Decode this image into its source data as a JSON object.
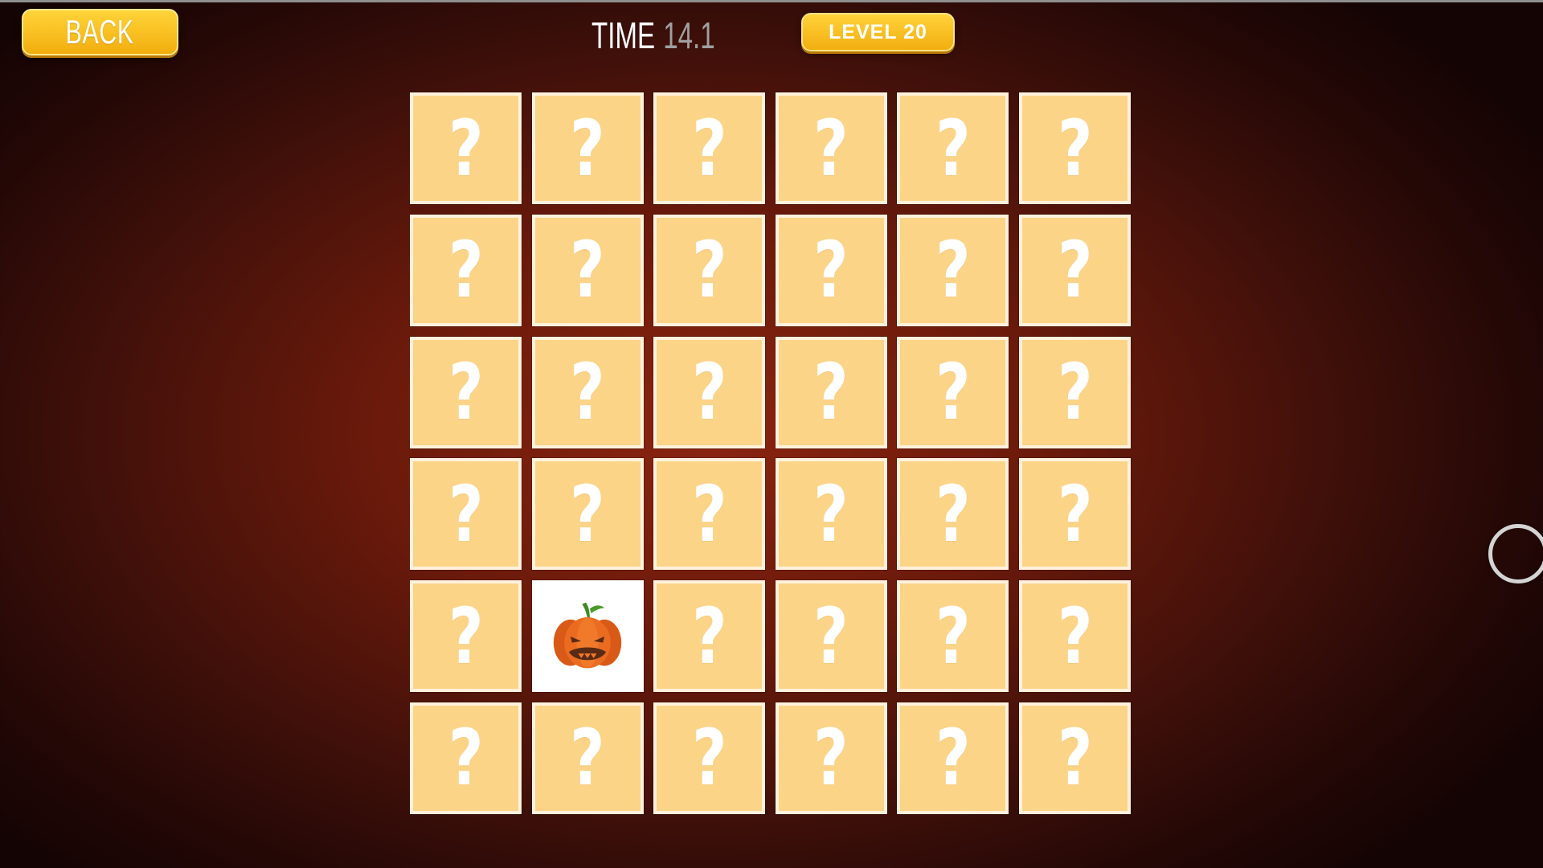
{
  "header": {
    "back_label": "BACK",
    "timer_label": "TIME",
    "timer_value": "14.1",
    "level_label": "LEVEL 20"
  },
  "board": {
    "rows": 6,
    "columns": 6,
    "hidden_symbol": "?",
    "cards": [
      {
        "face": "?"
      },
      {
        "face": "?"
      },
      {
        "face": "?"
      },
      {
        "face": "?"
      },
      {
        "face": "?"
      },
      {
        "face": "?"
      },
      {
        "face": "?"
      },
      {
        "face": "?"
      },
      {
        "face": "?"
      },
      {
        "face": "?"
      },
      {
        "face": "?"
      },
      {
        "face": "?"
      },
      {
        "face": "?"
      },
      {
        "face": "?"
      },
      {
        "face": "?"
      },
      {
        "face": "?"
      },
      {
        "face": "?"
      },
      {
        "face": "?"
      },
      {
        "face": "?"
      },
      {
        "face": "?"
      },
      {
        "face": "?"
      },
      {
        "face": "?"
      },
      {
        "face": "?"
      },
      {
        "face": "?"
      },
      {
        "face": "?"
      },
      {
        "face": "pumpkin-icon",
        "revealed": true
      },
      {
        "face": "?"
      },
      {
        "face": "?"
      },
      {
        "face": "?"
      },
      {
        "face": "?"
      },
      {
        "face": "?"
      },
      {
        "face": "?"
      },
      {
        "face": "?"
      },
      {
        "face": "?"
      },
      {
        "face": "?"
      },
      {
        "face": "?"
      }
    ]
  },
  "colors": {
    "button_yellow": "#f7bd1f",
    "card_hidden": "#fcd488",
    "card_border": "#fff1dc",
    "background_red": "#7a1e0d",
    "pumpkin_orange": "#e9651e",
    "timer_value_gray": "#a0a0a0"
  },
  "icons": {
    "revealed_card": "pumpkin-icon",
    "touch_indicator": "cursor-ring-icon"
  }
}
